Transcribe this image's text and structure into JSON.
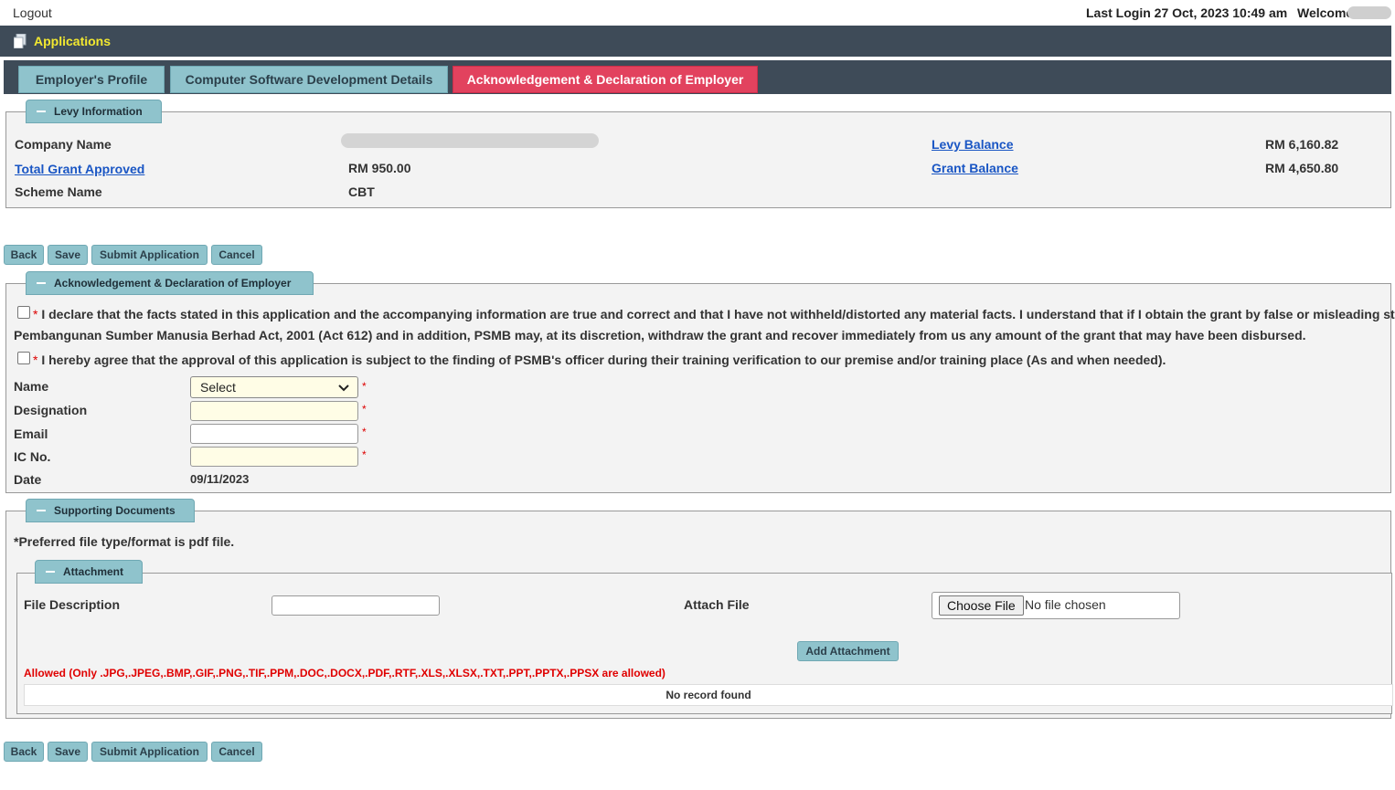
{
  "topbar": {
    "logout": "Logout",
    "last_login": "Last Login 27 Oct, 2023 10:49 am",
    "welcome": "Welcome"
  },
  "appbar": {
    "title": "Applications"
  },
  "tabs": [
    {
      "label": "Employer's Profile"
    },
    {
      "label": "Computer Software Development Details"
    },
    {
      "label": "Acknowledgement & Declaration of Employer",
      "active": true
    }
  ],
  "levy": {
    "legend": "Levy Information",
    "company_name_label": "Company Name",
    "total_grant_label": "Total Grant Approved",
    "total_grant_value": "RM 950.00",
    "scheme_label": "Scheme Name",
    "scheme_value": "CBT",
    "levy_balance_label": "Levy Balance",
    "levy_balance_value": "RM 6,160.82",
    "grant_balance_label": "Grant Balance",
    "grant_balance_value": "RM 4,650.80"
  },
  "buttons": {
    "back": "Back",
    "save": "Save",
    "submit": "Submit Application",
    "cancel": "Cancel"
  },
  "declaration": {
    "legend": "Acknowledgement & Declaration of Employer",
    "required_mark": "*",
    "statement1_line1": " I declare that the facts stated in this application and the accompanying information are true and correct and that I have not withheld/distorted any material facts. I understand that if I obtain the grant by false or misleading statement",
    "statement1_line2": "Pembangunan Sumber Manusia Berhad Act, 2001 (Act 612) and in addition, PSMB may, at its discretion, withdraw the grant and recover immediately from us any amount of the grant that may have been disbursed.",
    "statement2": " I hereby agree that the approval of this application is subject to the finding of PSMB's officer during their training verification to our premise and/or training place (As and when needed).",
    "name_label": "Name",
    "name_selected": "Select",
    "designation_label": "Designation",
    "email_label": "Email",
    "ic_label": "IC No.",
    "date_label": "Date",
    "date_value": "09/11/2023"
  },
  "supporting": {
    "legend": "Supporting Documents",
    "note": "*Preferred file type/format is pdf file.",
    "attachment_legend": "Attachment",
    "file_desc_label": "File Description",
    "attach_file_label": "Attach File",
    "choose_file": "Choose File",
    "no_file": "No file chosen",
    "add_attachment": "Add Attachment",
    "allowed": "Allowed (Only .JPG,.JPEG,.BMP,.GIF,.PNG,.TIF,.PPM,.DOC,.DOCX,.PDF,.RTF,.XLS,.XLSX,.TXT,.PPT,.PPTX,.PPSX are allowed)",
    "no_record": "No record found"
  },
  "colors": {
    "header_bg": "#3e4b58",
    "tab_bg": "#8fc3cc",
    "tab_active_bg": "#e2425e",
    "title_yellow": "#f2e830",
    "link_blue": "#1a56c4",
    "error_red": "#e00000"
  }
}
